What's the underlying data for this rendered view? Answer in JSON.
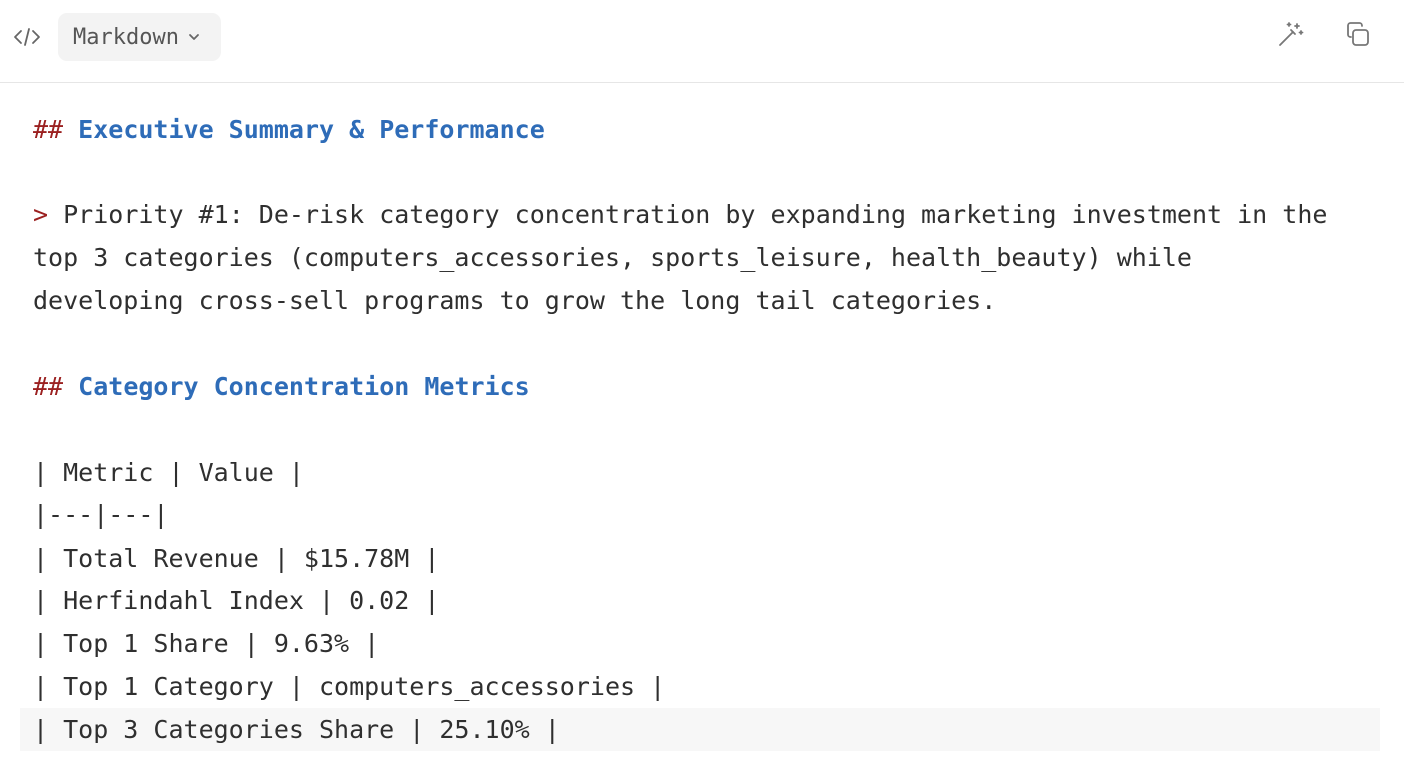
{
  "toolbar": {
    "language": "Markdown",
    "code_icon": "code-icon",
    "wand_icon": "magic-wand-icon",
    "copy_icon": "copy-icon"
  },
  "editor": {
    "heading1": {
      "hash": "##",
      "text": "Executive Summary & Performance"
    },
    "quote": {
      "mark": ">",
      "line1": "Priority #1: De-risk category concentration by expanding marketing investment in the",
      "line2": "top 3 categories (computers_accessories, sports_leisure, health_beauty) while",
      "line3": "developing cross-sell programs to grow the long tail categories."
    },
    "heading2": {
      "hash": "##",
      "text": "Category Concentration Metrics"
    },
    "table_lines": [
      "| Metric | Value |",
      "|---|---|",
      "| Total Revenue | $15.78M |",
      "| Herfindahl Index | 0.02 |",
      "| Top 1 Share | 9.63% |",
      "| Top 1 Category | computers_accessories |",
      "| Top 3 Categories Share | 25.10% |"
    ]
  },
  "colors": {
    "heading": "#2e6cb8",
    "markup": "#9b2020",
    "text": "#2f2f2f",
    "highlight": "#f7f7f7"
  }
}
